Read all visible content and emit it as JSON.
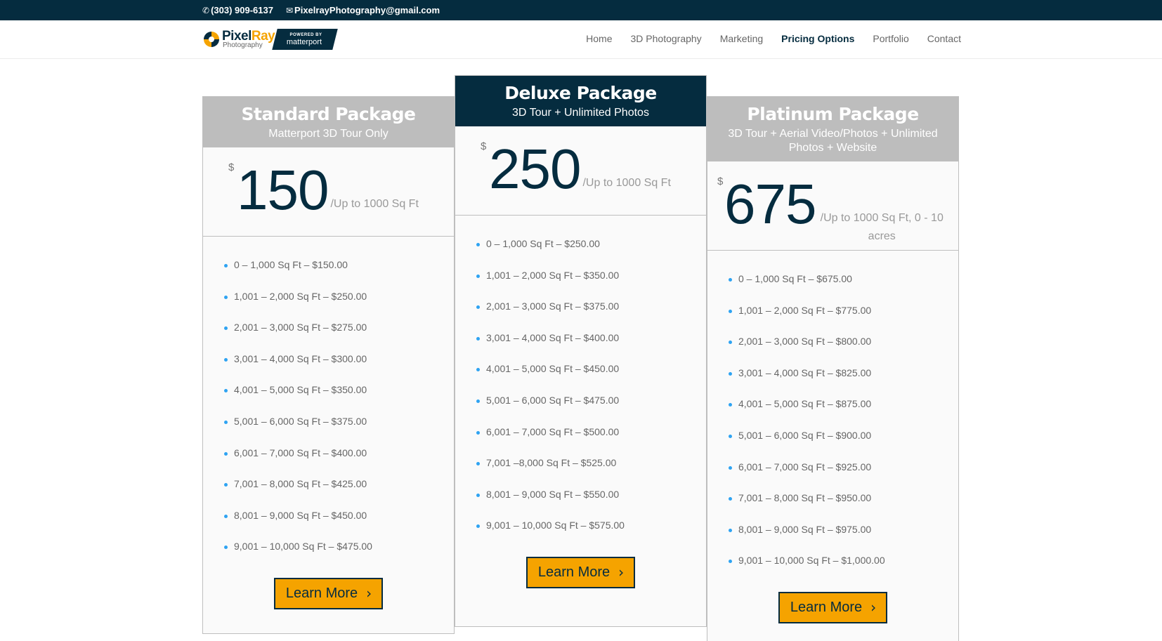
{
  "topbar": {
    "phone": "(303) 909-6137",
    "email": "PixelrayPhotography@gmail.com"
  },
  "logo": {
    "title_a": "Pixel",
    "title_b": "Ray",
    "subtitle": "Photography",
    "badge_top": "POWERED BY",
    "badge_name": "matterport"
  },
  "nav": [
    {
      "label": "Home"
    },
    {
      "label": "3D Photography"
    },
    {
      "label": "Marketing"
    },
    {
      "label": "Pricing Options",
      "active": true
    },
    {
      "label": "Portfolio"
    },
    {
      "label": "Contact"
    }
  ],
  "colors": {
    "navy": "#052c3f",
    "accent": "#f5a300",
    "bullet": "#2ea3f2",
    "card_head_gray": "#bdbdbd"
  },
  "plans": [
    {
      "title": "Standard Package",
      "subtitle": "Matterport 3D Tour Only",
      "currency": "$",
      "price": "150",
      "per": "/Up to 1000 Sq Ft",
      "features": [
        "0 – 1,000 Sq Ft – $150.00",
        "1,001 – 2,000 Sq Ft – $250.00",
        "2,001 – 3,000 Sq Ft – $275.00",
        "3,001 – 4,000 Sq Ft – $300.00",
        "4,001 – 5,000 Sq Ft – $350.00",
        "5,001 – 6,000 Sq Ft – $375.00",
        "6,001 – 7,000 Sq Ft – $400.00",
        "7,001 – 8,000 Sq Ft – $425.00",
        "8,001 – 9,000 Sq Ft – $450.00",
        "9,001 – 10,000 Sq Ft – $475.00"
      ],
      "button": "Learn More"
    },
    {
      "title": "Deluxe Package",
      "subtitle": "3D Tour + Unlimited Photos",
      "currency": "$",
      "price": "250",
      "per": "/Up to 1000 Sq Ft",
      "features": [
        "0 – 1,000 Sq Ft – $250.00",
        "1,001 – 2,000 Sq Ft – $350.00",
        "2,001 – 3,000 Sq Ft – $375.00",
        "3,001 – 4,000 Sq Ft – $400.00",
        "4,001 – 5,000 Sq Ft – $450.00",
        "5,001 – 6,000 Sq Ft – $475.00",
        "6,001 – 7,000 Sq Ft – $500.00",
        "7,001 –8,000 Sq Ft – $525.00",
        "8,001 – 9,000 Sq Ft – $550.00",
        "9,001 – 10,000 Sq Ft – $575.00"
      ],
      "button": "Learn More"
    },
    {
      "title": "Platinum Package",
      "subtitle": "3D Tour + Aerial Video/Photos + Unlimited Photos + Website",
      "currency": "$",
      "price": "675",
      "per": "/Up to 1000 Sq Ft, 0 - 10 acres",
      "features": [
        "0 – 1,000 Sq Ft – $675.00",
        "1,001 – 2,000 Sq Ft – $775.00",
        "2,001 – 3,000 Sq Ft – $800.00",
        "3,001 – 4,000 Sq Ft – $825.00",
        "4,001 – 5,000 Sq Ft – $875.00",
        "5,001 – 6,000 Sq Ft – $900.00",
        "6,001 – 7,000 Sq Ft – $925.00",
        "7,001 – 8,000 Sq Ft – $950.00",
        "8,001 – 9,000 Sq Ft – $975.00",
        "9,001 – 10,000 Sq Ft – $1,000.00"
      ],
      "button": "Learn More"
    }
  ]
}
